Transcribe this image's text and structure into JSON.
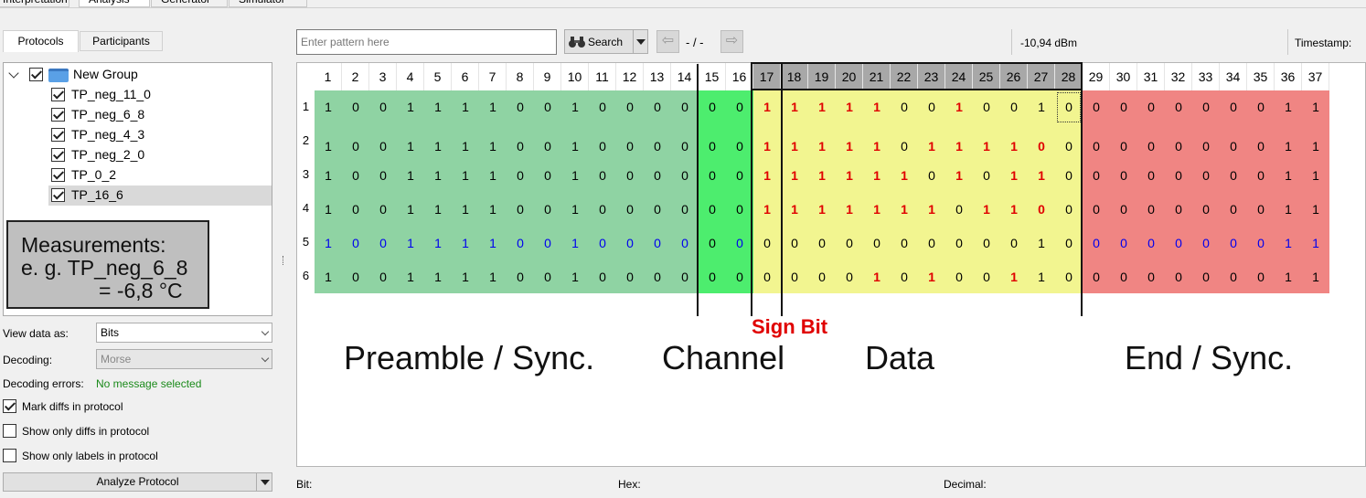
{
  "tabs": [
    "Interpretation",
    "Analysis",
    "Generator",
    "Simulator"
  ],
  "left": {
    "subtabs": [
      "Protocols",
      "Participants"
    ],
    "tree": {
      "group": "New Group",
      "items": [
        "TP_neg_11_0",
        "TP_neg_6_8",
        "TP_neg_4_3",
        "TP_neg_2_0",
        "TP_0_2",
        "TP_16_6"
      ],
      "selected_index": 5
    },
    "measurement_note": [
      "Measurements:",
      "e. g. TP_neg_6_8",
      "= -6,8 °C"
    ],
    "view_data_label": "View data as:",
    "view_data_value": "Bits",
    "decoding_label": "Decoding:",
    "decoding_value": "Morse",
    "decoding_errors_label": "Decoding errors:",
    "decoding_errors_value": "No message selected",
    "checkboxes": [
      {
        "label": "Mark diffs in protocol",
        "checked": true
      },
      {
        "label": "Show only diffs in protocol",
        "checked": false
      },
      {
        "label": "Show only labels in protocol",
        "checked": false
      }
    ],
    "analyze_button": "Analyze Protocol"
  },
  "toolbar": {
    "pattern_placeholder": "Enter pattern here",
    "search_label": "Search",
    "nav_text": "- / -",
    "rssi": "-10,94 dBm",
    "timestamp_label": "Timestamp:"
  },
  "columns": [
    1,
    2,
    3,
    4,
    5,
    6,
    7,
    8,
    9,
    10,
    11,
    12,
    13,
    14,
    15,
    16,
    17,
    18,
    19,
    20,
    21,
    22,
    23,
    24,
    25,
    26,
    27,
    28,
    29,
    30,
    31,
    32,
    33,
    34,
    35,
    36,
    37
  ],
  "rows": [
    {
      "num": "1",
      "bits": "1001111001000000111110010010",
      "end": "000000011"
    },
    {
      "num": "2",
      "bits": "1001111001000000111110111100",
      "end": "000000011"
    },
    {
      "num": "3",
      "bits": "1001111001000000111111010110",
      "end": "000000011"
    },
    {
      "num": "4",
      "bits": "1001111001000000111111101100",
      "end": "000000011"
    },
    {
      "num": "5",
      "bits": "1001111001000000000000000010",
      "end": "000000011"
    },
    {
      "num": "6",
      "bits": "1001111001000000000010100110",
      "end": "000000011"
    }
  ],
  "sections": {
    "preamble": "Preamble / Sync.",
    "channel": "Channel",
    "sign_bit": "Sign Bit",
    "data": "Data",
    "end": "End / Sync."
  },
  "status": {
    "bit": "Bit:",
    "hex": "Hex:",
    "decimal": "Decimal:"
  },
  "colors": {
    "preamble": "#8fd3a3",
    "channel": "#4ded6e",
    "data": "#f2f590",
    "end": "#f08583",
    "highlight_header": "#a8a8a8",
    "diff_red": "#e00000",
    "row5_blue": "#0000ee"
  }
}
